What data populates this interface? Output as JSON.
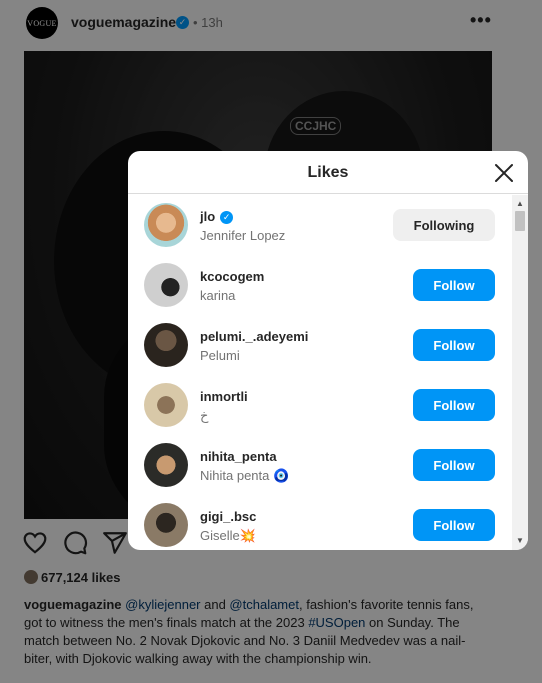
{
  "post": {
    "avatar_text": "VOGUE",
    "username": "voguemagazine",
    "time": "• 13h",
    "more_icon": "•••",
    "image_cap_text": "CCJHC",
    "likes_count": "677,124 likes",
    "caption": {
      "user": "voguemagazine",
      "mention1": "@kyliejenner",
      "and": " and ",
      "mention2": "@tchalamet",
      "text1": ", fashion's favorite tennis fans, got to witness the men's finals match at the 2023 ",
      "hashtag": "#USOpen",
      "text2": " on Sunday. The match between No. 2 Novak Djokovic and No. 3 Daniil Medvedev was a nail-biter, with Djokovic walking away with the championship win."
    }
  },
  "modal": {
    "title": "Likes",
    "close_icon": "close-icon",
    "users": [
      {
        "username": "jlo",
        "name": "Jennifer Lopez",
        "verified": true,
        "button": "Following",
        "avatar_color": "#d9a070"
      },
      {
        "username": "kcocogem",
        "name": "karina",
        "verified": false,
        "button": "Follow",
        "avatar_color": "#9a9a9a"
      },
      {
        "username": "pelumi._.adeyemi",
        "name": "Pelumi",
        "verified": false,
        "button": "Follow",
        "avatar_color": "#3a3026"
      },
      {
        "username": "inmortli",
        "name": "خ",
        "verified": false,
        "button": "Follow",
        "avatar_color": "#b8a48a"
      },
      {
        "username": "nihita_penta",
        "name": "Nihita penta 🧿",
        "verified": false,
        "button": "Follow",
        "avatar_color": "#4a4a44"
      },
      {
        "username": "gigi_.bsc",
        "name": "Giselle💥",
        "verified": false,
        "button": "Follow",
        "avatar_color": "#6e6052"
      }
    ]
  },
  "colors": {
    "accent": "#0095f6",
    "following_bg": "#efefef"
  }
}
